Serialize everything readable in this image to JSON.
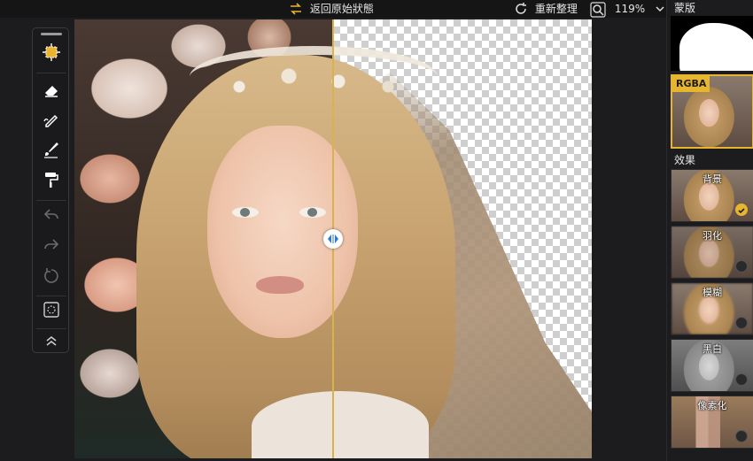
{
  "topbar": {
    "back_label": "返回原始狀態",
    "reset_label": "重新整理",
    "zoom": "119%"
  },
  "toolbar": {
    "tools": [
      "move-tool",
      "eraser-tool",
      "restore-brush-tool",
      "paint-brush-tool",
      "fill-roller-tool"
    ],
    "actions": [
      "undo",
      "redo",
      "reset",
      "fit-screen",
      "collapse"
    ]
  },
  "right_panel": {
    "mask_label": "蒙版",
    "rgba_label": "RGBA",
    "effects_label": "效果",
    "effects": [
      {
        "label": "背景",
        "selected": true
      },
      {
        "label": "羽化",
        "selected": false
      },
      {
        "label": "模糊",
        "selected": false
      },
      {
        "label": "黑白",
        "selected": false
      },
      {
        "label": "像素化",
        "selected": false
      }
    ]
  },
  "colors": {
    "accent": "#e8b52e",
    "background": "#1c1c1e"
  }
}
